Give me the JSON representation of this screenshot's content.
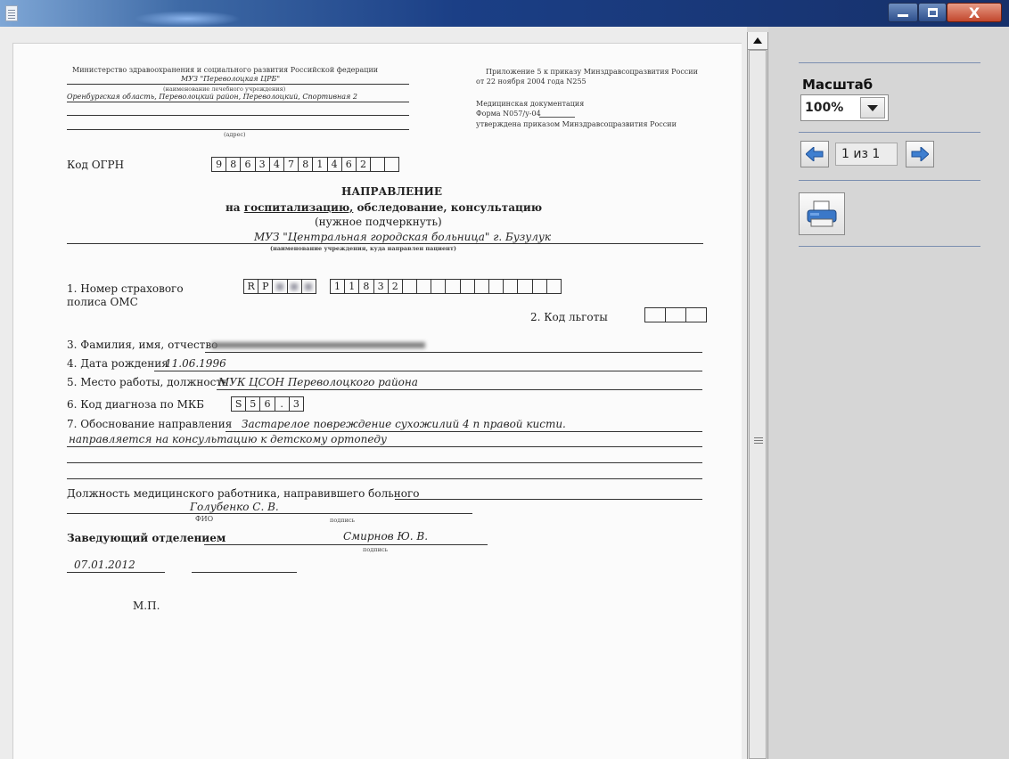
{
  "window": {
    "controls": [
      "minimize-icon",
      "maximize-icon",
      "close-icon"
    ],
    "close_glyph": "X",
    "accent_color": "#1b3f86"
  },
  "form": {
    "org": {
      "ministry": "Министерство здравоохранения и социального развития Российской федерации",
      "institution": "МУЗ \"Переволоцкая ЦРБ\"",
      "institution_caption": "(наименование лечебного учреждения)",
      "address": "Оренбургская область, Переволоцкий район, Переволоцкий, Спортивная 2",
      "address_caption": "(адрес)"
    },
    "appendix": {
      "line1": "Приложение 5 к приказу Минздравсоцразвития России",
      "line2": "от 22 ноября 2004 года N255",
      "line3": "Медицинская документация",
      "line4": "Форма N057/у-04",
      "line5": "утверждена приказом Минздравсоцразвития России"
    },
    "ogrn": {
      "label": "Код ОГРН",
      "digits": [
        "9",
        "8",
        "6",
        "3",
        "4",
        "7",
        "8",
        "1",
        "4",
        "6",
        "2",
        "",
        ""
      ]
    },
    "title": "НАПРАВЛЕНИЕ",
    "subtitle_prefix": "на",
    "subtitle_underlined": "госпитализацию,",
    "subtitle_rest": "обследование, консультацию",
    "subtitle_note": "(нужное подчеркнуть)",
    "target_institution": "МУЗ \"Центральная городская больница\" г. Бузулук",
    "target_caption": "(наименование учреждения, куда направлен пациент)",
    "policy": {
      "label_line1": "1. Номер страхового",
      "label_line2": "полиса ОМС",
      "cells": [
        "R",
        "P",
        "",
        "",
        "",
        "1",
        "1",
        "8",
        "3",
        "2",
        "",
        "",
        "",
        "",
        "",
        "",
        "",
        ""
      ]
    },
    "benefit": {
      "label": "2. Код льготы"
    },
    "fields": {
      "fio_label": "3. Фамилия, имя, отчество",
      "dob_label": "4. Дата рождения",
      "dob_value": "11.06.1996",
      "work_label": "5. Место работы, должность",
      "work_value": "МУК ЦСОН Переволоцкого района",
      "mkb_label": "6. Код диагноза по МКБ",
      "mkb_cells": [
        "S",
        "5",
        "6",
        ".",
        "3"
      ],
      "reason_label": "7. Обоснование направления",
      "reason_value1": "Застарелое повреждение сухожилий 4 п правой кисти.",
      "reason_value2": "направляется на консультацию к детскому ортопеду"
    },
    "signatures": {
      "doctor_label": "Должность медицинского работника, направившего больного",
      "doctor_name": "Голубенко С. В.",
      "fio_caption": "ФИО",
      "sign_caption": "подпись",
      "head_label": "Заведующий отделением",
      "head_name": "Смирнов Ю. В.",
      "date": "07.01.2012",
      "stamp": "М.П."
    }
  },
  "sidebar": {
    "scale_label": "Масштаб",
    "scale_value": "100%",
    "page_indicator": "1 из 1",
    "prev_icon": "arrow-left-icon",
    "next_icon": "arrow-right-icon",
    "print_icon": "printer-icon"
  }
}
